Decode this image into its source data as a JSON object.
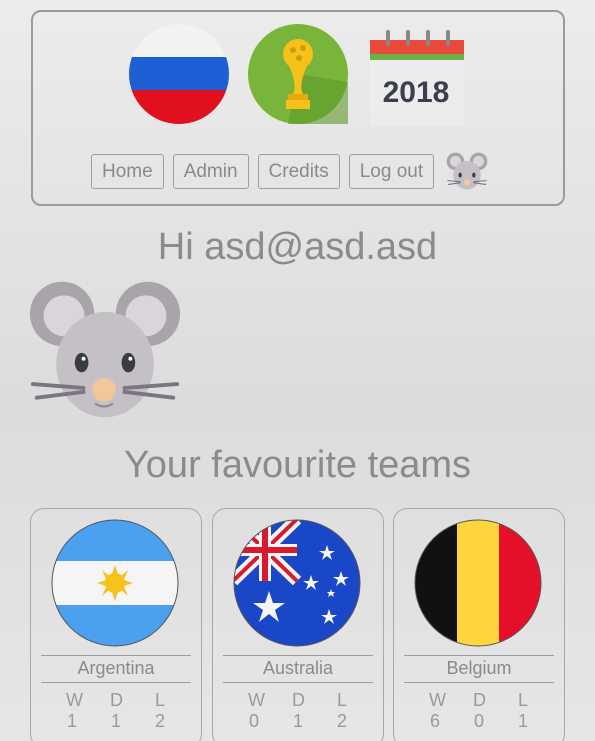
{
  "nav": {
    "home_label": "Home",
    "admin_label": "Admin",
    "credits_label": "Credits",
    "logout_label": "Log out"
  },
  "header": {
    "calendar_year": "2018"
  },
  "greeting": "Hi asd@asd.asd",
  "favourites": {
    "title": "Your favourite teams",
    "stat_headers": {
      "w": "W",
      "d": "D",
      "l": "L"
    },
    "teams": [
      {
        "name": "Argentina",
        "w": "1",
        "d": "1",
        "l": "2"
      },
      {
        "name": "Australia",
        "w": "0",
        "d": "1",
        "l": "2"
      },
      {
        "name": "Belgium",
        "w": "6",
        "d": "0",
        "l": "1"
      }
    ]
  },
  "colors": {
    "russia_white": "#f2f2f2",
    "russia_blue": "#1f5fd6",
    "russia_red": "#e0101e",
    "cup_bg": "#79b53a",
    "cup_gold": "#f5c21b",
    "argentina_blue": "#4ba0f0",
    "australia_blue": "#1a47c8",
    "belgium_black": "#111111",
    "belgium_yellow": "#ffd53d",
    "belgium_red": "#e60f2a"
  }
}
